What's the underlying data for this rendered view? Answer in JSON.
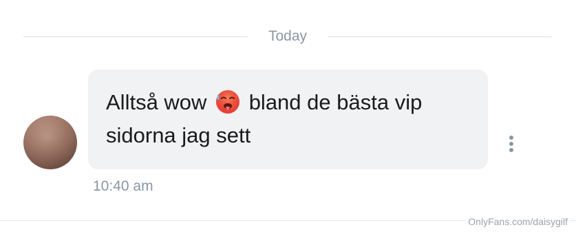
{
  "divider": {
    "label": "Today"
  },
  "message": {
    "text_before": "Alltså wow",
    "emoji": "hot-face-emoji",
    "text_after": "bland de bästa vip sidorna jag sett",
    "time": "10:40 am"
  },
  "icons": {
    "more": "more-vertical-icon",
    "avatar": "sender-avatar"
  },
  "watermark": {
    "text": "OnlyFans.com/daisygilf"
  },
  "colors": {
    "bubble": "#f0f2f4",
    "muted_text": "#8a96a3",
    "divider_line": "#d9dde2",
    "message_text": "#1a1a1a"
  }
}
